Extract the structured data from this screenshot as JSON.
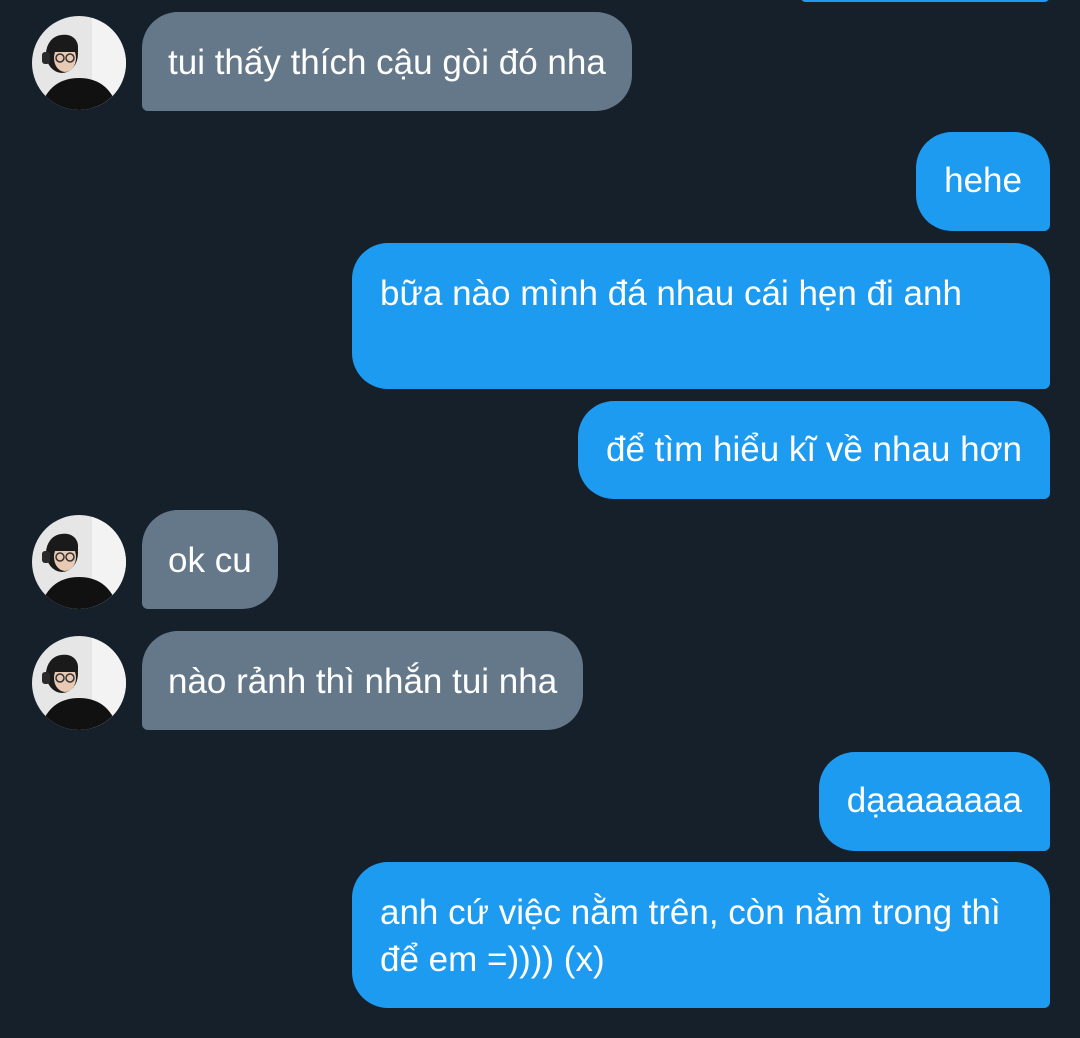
{
  "conversation": {
    "messages": [
      {
        "sender": "them",
        "text": "tui thấy thích cậu gòi đó nha"
      },
      {
        "sender": "me",
        "text": "hehe"
      },
      {
        "sender": "me",
        "text": "bữa nào mình đá nhau cái hẹn đi anh"
      },
      {
        "sender": "me",
        "text": "để tìm hiểu kĩ về nhau hơn"
      },
      {
        "sender": "them",
        "text": "ok cu"
      },
      {
        "sender": "them",
        "text": "nào rảnh thì nhắn tui nha"
      },
      {
        "sender": "me",
        "text": "dạaaaaaaa"
      },
      {
        "sender": "me",
        "text": "anh cứ việc nằm trên, còn nằm trong thì để em =)))) (x)"
      }
    ]
  },
  "colors": {
    "background": "#15202b",
    "incoming_bubble": "#65788a",
    "outgoing_bubble": "#1d9bf0",
    "text": "#ffffff"
  },
  "icons": {
    "avatar": "avatar"
  }
}
